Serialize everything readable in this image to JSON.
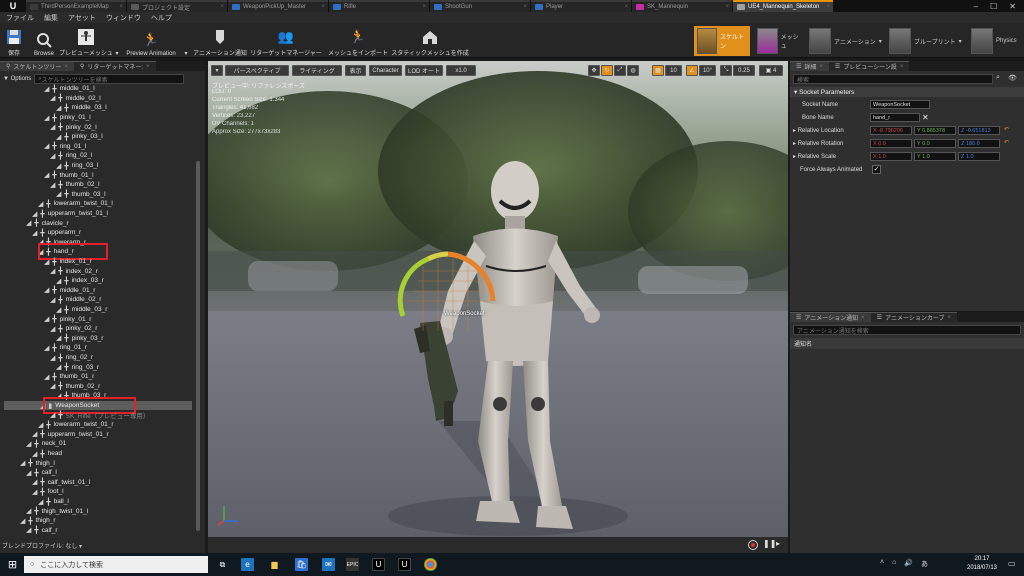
{
  "tabs": [
    {
      "label": "ThirdPersonExampleMap",
      "color": "#3a3a3a"
    },
    {
      "label": "プロジェクト設定",
      "color": "#5a5a5a"
    },
    {
      "label": "WeaponPickUp_Master",
      "color": "#2f6fc6"
    },
    {
      "label": "Rifle",
      "color": "#2f6fc6"
    },
    {
      "label": "ShootGun",
      "color": "#2f6fc6"
    },
    {
      "label": "Player",
      "color": "#2f6fc6"
    },
    {
      "label": "SK_Mannequin",
      "color": "#c42fa8"
    },
    {
      "label": "UE4_Mannequin_Skeleton",
      "color": "#a0a0a0"
    }
  ],
  "menu": [
    "ファイル",
    "編集",
    "アセット",
    "ウィンドウ",
    "ヘルプ"
  ],
  "toolbar": {
    "save": "保存",
    "browse": "Browse",
    "preview_mesh": "プレビューメッシュ",
    "preview_animation": "Preview Animation",
    "anim_notify": "アニメーション通知",
    "retarget_manager": "リターゲットマネージャー",
    "import_mesh": "メッシュをインポート",
    "make_static_mesh": "スタティックメッシュを作成"
  },
  "modes": {
    "skeleton": "スケルトン",
    "mesh": "メッシュ",
    "animation": "アニメーション",
    "blueprint": "ブループリント",
    "physics": "Physics"
  },
  "left_panel": {
    "tab1": "スケルトンツリー",
    "tab2": "リターゲットマネー:",
    "options": "Options",
    "search_placeholder": "スケルトンツリーを検索",
    "bones": [
      {
        "name": "middle_01_l",
        "depth": 5
      },
      {
        "name": "middle_02_l",
        "depth": 6
      },
      {
        "name": "middle_03_l",
        "depth": 7
      },
      {
        "name": "pinky_01_l",
        "depth": 5
      },
      {
        "name": "pinky_02_l",
        "depth": 6
      },
      {
        "name": "pinky_03_l",
        "depth": 7
      },
      {
        "name": "ring_01_l",
        "depth": 5
      },
      {
        "name": "ring_02_l",
        "depth": 6
      },
      {
        "name": "ring_03_l",
        "depth": 7
      },
      {
        "name": "thumb_01_l",
        "depth": 5
      },
      {
        "name": "thumb_02_l",
        "depth": 6
      },
      {
        "name": "thumb_03_l",
        "depth": 7
      },
      {
        "name": "lowerarm_twist_01_l",
        "depth": 4
      },
      {
        "name": "upperarm_twist_01_l",
        "depth": 3
      },
      {
        "name": "clavicle_r",
        "depth": 2
      },
      {
        "name": "upperarm_r",
        "depth": 3
      },
      {
        "name": "lowerarm_r",
        "depth": 4
      },
      {
        "name": "hand_r",
        "depth": 4
      },
      {
        "name": "index_01_r",
        "depth": 5
      },
      {
        "name": "index_02_r",
        "depth": 6
      },
      {
        "name": "index_03_r",
        "depth": 7
      },
      {
        "name": "middle_01_r",
        "depth": 5
      },
      {
        "name": "middle_02_r",
        "depth": 6
      },
      {
        "name": "middle_03_r",
        "depth": 7
      },
      {
        "name": "pinky_01_r",
        "depth": 5
      },
      {
        "name": "pinky_02_r",
        "depth": 6
      },
      {
        "name": "pinky_03_r",
        "depth": 7
      },
      {
        "name": "ring_01_r",
        "depth": 5
      },
      {
        "name": "ring_02_r",
        "depth": 6
      },
      {
        "name": "ring_03_r",
        "depth": 7
      },
      {
        "name": "thumb_01_r",
        "depth": 5
      },
      {
        "name": "thumb_02_r",
        "depth": 6
      },
      {
        "name": "thumb_03_r",
        "depth": 7
      },
      {
        "name": "WeaponSocket",
        "depth": 5
      },
      {
        "name": "SK_Rifle（プレビュー専用）",
        "depth": 6
      },
      {
        "name": "lowerarm_twist_01_r",
        "depth": 4
      },
      {
        "name": "upperarm_twist_01_r",
        "depth": 3
      },
      {
        "name": "neck_01",
        "depth": 2
      },
      {
        "name": "head",
        "depth": 3
      },
      {
        "name": "thigh_l",
        "depth": 1
      },
      {
        "name": "calf_l",
        "depth": 2
      },
      {
        "name": "calf_twist_01_l",
        "depth": 3
      },
      {
        "name": "foot_l",
        "depth": 3
      },
      {
        "name": "ball_l",
        "depth": 4
      },
      {
        "name": "thigh_twist_01_l",
        "depth": 2
      },
      {
        "name": "thigh_r",
        "depth": 1
      },
      {
        "name": "calf_r",
        "depth": 2
      }
    ],
    "blend_profile_label": "ブレンドプロファイル: なし"
  },
  "viewport": {
    "perspective": "パースペクティブ",
    "lighting": "ライティング",
    "show": "表示",
    "character": "Character",
    "lod": "LOD オート",
    "speed": "x1.0",
    "grid_snap": "10",
    "rot_snap": "10°",
    "scale_snap": "0.25",
    "cam_speed": "4",
    "info": [
      "プレビュー中: リファレンスポーズ",
      "LOD: 0",
      "Current Screen Size: 1.344",
      "Triangles: 41,682",
      "Vertices: 23,227",
      "UV Channels: 1",
      "Approx Size: 277x73x283"
    ],
    "socket_label": "WeaponSocket"
  },
  "details": {
    "tab1": "詳細",
    "tab2": "プレビューシーン設",
    "search_placeholder": "検索",
    "section": "Socket Parameters",
    "socket_name_label": "Socket Name",
    "socket_name": "WeaponSocket",
    "bone_name_label": "Bone Name",
    "bone_name": "hand_r",
    "rel_loc_label": "Relative Location",
    "rel_loc": {
      "x": "X -8.796206",
      "y": "Y 6.885378",
      "z": "Z -0.651813"
    },
    "rel_rot_label": "Relative Rotation",
    "rel_rot": {
      "x": "X 0.0",
      "y": "Y 0.0",
      "z": "Z 180.0"
    },
    "rel_scale_label": "Relative Scale",
    "rel_scale": {
      "x": "X 1.0",
      "y": "Y 1.0",
      "z": "Z 1.0"
    },
    "force_anim_label": "Force Always Animated"
  },
  "notify": {
    "tab1": "アニメーション通知",
    "tab2": "アニメーションカーブ",
    "search_placeholder": "アニメーション通知を検索",
    "col": "通知名"
  },
  "taskbar": {
    "search_placeholder": "ここに入力して検索",
    "time": "20:17",
    "date": "2018/07/13"
  }
}
